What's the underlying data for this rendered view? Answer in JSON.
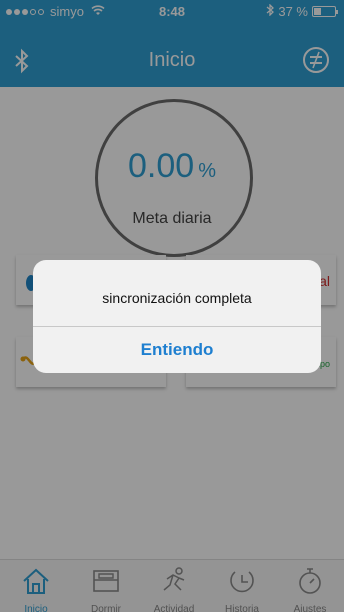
{
  "status_bar": {
    "carrier": "simyo",
    "time": "8:48",
    "battery_text": "37 %",
    "battery_level": 0.37
  },
  "nav": {
    "title": "Inicio",
    "left_icon": "bluetooth-icon",
    "right_icon": "menu-circle-icon"
  },
  "goal": {
    "value": "0.00",
    "unit": "%",
    "label": "Meta diaria"
  },
  "cards": [
    {
      "icon": "footprint-icon",
      "text": ""
    },
    {
      "icon": "calorie-icon",
      "text": "al"
    },
    {
      "icon": "distance-icon",
      "text": ""
    },
    {
      "icon": "time-ring-icon",
      "text": "mpo"
    }
  ],
  "tabs": [
    {
      "label": "Inicio",
      "icon": "home-icon",
      "active": true
    },
    {
      "label": "Dormir",
      "icon": "bed-icon",
      "active": false
    },
    {
      "label": "Actividad",
      "icon": "runner-icon",
      "active": false
    },
    {
      "label": "Historia",
      "icon": "clock-icon",
      "active": false
    },
    {
      "label": "Ajustes",
      "icon": "timer-icon",
      "active": false
    }
  ],
  "alert": {
    "message": "sincronización completa",
    "button_label": "Entiendo"
  },
  "colors": {
    "primary": "#2f9ed3",
    "alert_button": "#1e7fd0",
    "calorie_red": "#d32f2f",
    "time_green": "#2aa84a"
  }
}
